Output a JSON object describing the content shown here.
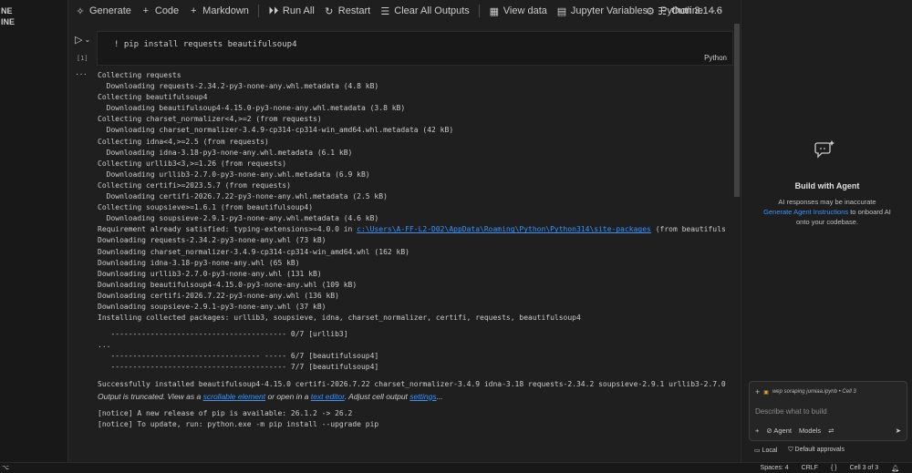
{
  "explorer": {
    "items": [
      "NE",
      "INE"
    ]
  },
  "toolbar": {
    "generate": "Generate",
    "code": "Code",
    "markdown": "Markdown",
    "run_all": "Run All",
    "restart": "Restart",
    "clear_all_outputs": "Clear All Outputs",
    "view_data": "View data",
    "jupyter_variables": "Jupyter Variables",
    "outline": "Outline",
    "more": "···",
    "kernel": "Python 3.14.6"
  },
  "cell": {
    "execution_count": "[1]",
    "source": "! pip install requests beautifulsoup4",
    "language": "Python"
  },
  "output": {
    "dots": "···",
    "lines": [
      "Collecting requests",
      "  Downloading requests-2.34.2-py3-none-any.whl.metadata (4.8 kB)",
      "Collecting beautifulsoup4",
      "  Downloading beautifulsoup4-4.15.0-py3-none-any.whl.metadata (3.8 kB)",
      "Collecting charset_normalizer<4,>=2 (from requests)",
      "  Downloading charset_normalizer-3.4.9-cp314-cp314-win_amd64.whl.metadata (42 kB)",
      "Collecting idna<4,>=2.5 (from requests)",
      "  Downloading idna-3.18-py3-none-any.whl.metadata (6.1 kB)",
      "Collecting urllib3<3,>=1.26 (from requests)",
      "  Downloading urllib3-2.7.0-py3-none-any.whl.metadata (6.9 kB)",
      "Collecting certifi>=2023.5.7 (from requests)",
      "  Downloading certifi-2026.7.22-py3-none-any.whl.metadata (2.5 kB)",
      "Collecting soupsieve>=1.6.1 (from beautifulsoup4)",
      "  Downloading soupsieve-2.9.1-py3-none-any.whl.metadata (4.6 kB)"
    ],
    "requirement_prefix": "Requirement already satisfied: typing-extensions>=4.0.0 in ",
    "requirement_path": "c:\\Users\\A-FF-L2-D02\\AppData\\Roaming\\Python\\Python314\\site-packages",
    "requirement_suffix": " (from beautifuls",
    "lines2": [
      "Downloading requests-2.34.2-py3-none-any.whl (73 kB)",
      "Downloading charset_normalizer-3.4.9-cp314-cp314-win_amd64.whl (162 kB)",
      "Downloading idna-3.18-py3-none-any.whl (65 kB)",
      "Downloading urllib3-2.7.0-py3-none-any.whl (131 kB)",
      "Downloading beautifulsoup4-4.15.0-py3-none-any.whl (109 kB)",
      "Downloading certifi-2026.7.22-py3-none-any.whl (136 kB)",
      "Downloading soupsieve-2.9.1-py3-none-any.whl (37 kB)",
      "Installing collected packages: urllib3, soupsieve, idna, charset_normalizer, certifi, requests, beautifulsoup4"
    ],
    "progress1": "   ---------------------------------------- 0/7 [urllib3]",
    "ellipsis": "...",
    "progress2": "   ---------------------------------- ----- 6/7 [beautifulsoup4]",
    "progress3": "   ---------------------------------------- 7/7 [beautifulsoup4]",
    "success": "Successfully installed beautifulsoup4-4.15.0 certifi-2026.7.22 charset_normalizer-3.4.9 idna-3.18 requests-2.34.2 soupsieve-2.9.1 urllib3-2.7.0",
    "truncated_prefix": "Output is truncated. View as a ",
    "truncated_link1": "scrollable element",
    "truncated_middle": " or open in a ",
    "truncated_link2": "text editor",
    "truncated_middle2": ". Adjust cell output ",
    "truncated_link3": "settings",
    "truncated_suffix": "...",
    "notice1": "[notice] A new release of pip is available: 26.1.2 -> 26.2",
    "notice2": "[notice] To update, run: python.exe -m pip install --upgrade pip"
  },
  "chat": {
    "title": "Build with Agent",
    "desc_line1": "AI responses may be inaccurate",
    "desc_link": "Generate Agent Instructions",
    "desc_after_link": " to onboard AI",
    "desc_line3": "onto your codebase.",
    "context_file": "wep soraping jumiaa.ipynb • Cell 3",
    "placeholder": "Describe what to build",
    "agent_label": "Agent",
    "models_label": "Models",
    "local_label": "Local",
    "approvals_label": "Default approvals"
  },
  "status": {
    "spaces": "Spaces: 4",
    "eol": "CRLF",
    "cell": "Cell 3 of 3"
  }
}
